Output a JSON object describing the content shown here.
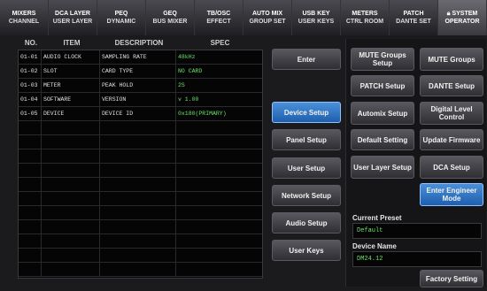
{
  "tabs": [
    {
      "l1": "MIXERS",
      "l2": "CHANNEL"
    },
    {
      "l1": "DCA LAYER",
      "l2": "USER LAYER"
    },
    {
      "l1": "PEQ",
      "l2": "DYNAMIC"
    },
    {
      "l1": "GEQ",
      "l2": "BUS MIXER"
    },
    {
      "l1": "TB/OSC",
      "l2": "EFFECT"
    },
    {
      "l1": "AUTO MIX",
      "l2": "GROUP SET"
    },
    {
      "l1": "USB KEY",
      "l2": "USER KEYS"
    },
    {
      "l1": "METERS",
      "l2": "CTRL ROOM"
    },
    {
      "l1": "PATCH",
      "l2": "DANTE SET"
    },
    {
      "l1": "SYSTEM",
      "l2": "OPERATOR"
    }
  ],
  "table": {
    "headers": {
      "no": "NO.",
      "item": "ITEM",
      "description": "DESCRIPTION",
      "spec": "SPEC"
    },
    "rows": [
      {
        "no": "01-01",
        "item": "AUDIO CLOCK",
        "description": "SAMPLING RATE",
        "spec": "48kHz"
      },
      {
        "no": "01-02",
        "item": "SLOT",
        "description": "CARD TYPE",
        "spec": "NO CARD"
      },
      {
        "no": "01-03",
        "item": "METER",
        "description": "PEAK HOLD",
        "spec": "2S"
      },
      {
        "no": "01-04",
        "item": "SOFTWARE",
        "description": "VERSION",
        "spec": "v 1.00"
      },
      {
        "no": "01-05",
        "item": "DEVICE",
        "description": "DEVICE ID",
        "spec": "0x180(PRIMARY)"
      }
    ]
  },
  "middle_buttons": {
    "enter": "Enter",
    "device_setup": "Device Setup",
    "panel_setup": "Panel Setup",
    "user_setup": "User Setup",
    "network_setup": "Network Setup",
    "audio_setup": "Audio Setup",
    "user_keys": "User Keys"
  },
  "right_buttons": {
    "mute_groups_setup": "MUTE Groups Setup",
    "mute_groups": "MUTE Groups",
    "patch_setup": "PATCH Setup",
    "dante_setup": "DANTE Setup",
    "automix_setup": "Automix Setup",
    "digital_level_control": "Digital Level Control",
    "default_setting": "Default Setting",
    "update_firmware": "Update Firmware",
    "user_layer_setup": "User Layer Setup",
    "dca_setup": "DCA Setup",
    "enter_engineer_mode": "Enter Engineer Mode",
    "factory_setting": "Factory Setting"
  },
  "current_preset": {
    "label": "Current Preset",
    "value": "Default"
  },
  "device_name": {
    "label": "Device Name",
    "value": "DM24.12"
  },
  "colors": {
    "accent_blue": "#2f78c8",
    "value_green": "#6be36b"
  }
}
